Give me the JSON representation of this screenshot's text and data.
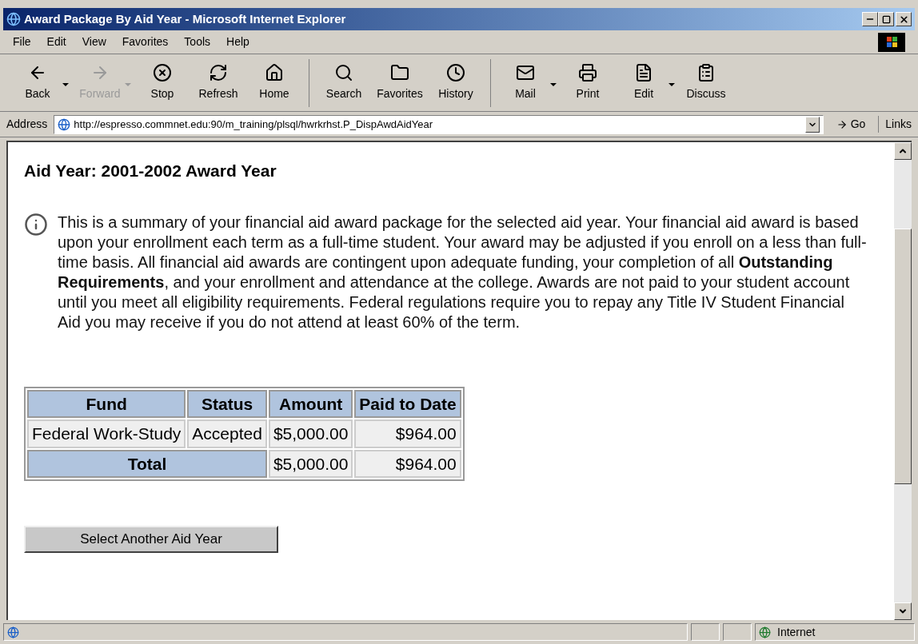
{
  "window": {
    "title": "Award Package By Aid Year - Microsoft Internet Explorer"
  },
  "menu": [
    "File",
    "Edit",
    "View",
    "Favorites",
    "Tools",
    "Help"
  ],
  "toolbar": [
    {
      "label": "Back",
      "disabled": false,
      "dropdown": true
    },
    {
      "label": "Forward",
      "disabled": true,
      "dropdown": true
    },
    {
      "label": "Stop",
      "disabled": false,
      "dropdown": false
    },
    {
      "label": "Refresh",
      "disabled": false,
      "dropdown": false
    },
    {
      "label": "Home",
      "disabled": false,
      "dropdown": false
    },
    {
      "label": "Search",
      "disabled": false,
      "dropdown": false
    },
    {
      "label": "Favorites",
      "disabled": false,
      "dropdown": false
    },
    {
      "label": "History",
      "disabled": false,
      "dropdown": false
    },
    {
      "label": "Mail",
      "disabled": false,
      "dropdown": true
    },
    {
      "label": "Print",
      "disabled": false,
      "dropdown": false
    },
    {
      "label": "Edit",
      "disabled": false,
      "dropdown": true
    },
    {
      "label": "Discuss",
      "disabled": false,
      "dropdown": false
    }
  ],
  "address": {
    "label": "Address",
    "value": "http://espresso.commnet.edu:90/m_training/plsql/hwrkrhst.P_DispAwdAidYear",
    "go": "Go",
    "links": "Links"
  },
  "page": {
    "heading": "Aid Year: 2001-2002 Award Year",
    "info": "This is a summary of your financial aid award package for the selected aid year. Your financial aid award is based upon your enrollment each term as a full-time student. Your award may be adjusted if you enroll on a less than full-time basis. All financial aid awards are contingent upon adequate funding, your completion of all **Outstanding Requirements**, and your enrollment and attendance at the college. Awards are not paid to your student account until you meet all eligibility requirements. Federal regulations require you to repay any Title IV Student Financial Aid you may receive if you do not attend at least 60% of the term.",
    "table": {
      "columns": [
        "Fund",
        "Status",
        "Amount",
        "Paid to Date"
      ],
      "rows": [
        {
          "fund": "Federal Work-Study",
          "status": "Accepted",
          "amount": "$5,000.00",
          "paid": "$964.00"
        }
      ],
      "total": {
        "label": "Total",
        "amount": "$5,000.00",
        "paid": "$964.00"
      }
    },
    "button": "Select Another Aid Year"
  },
  "status_bar": {
    "zone": "Internet"
  }
}
